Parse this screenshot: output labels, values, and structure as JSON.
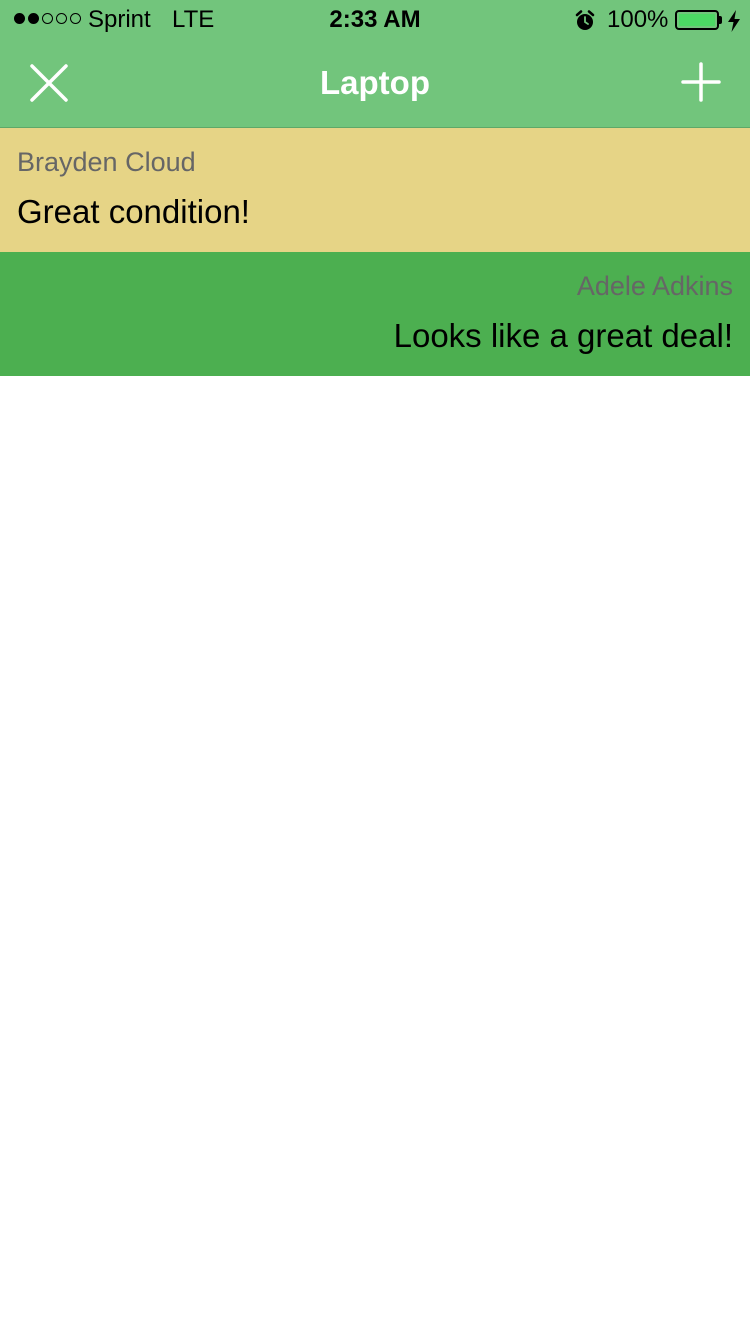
{
  "status_bar": {
    "signal_filled": 2,
    "signal_total": 5,
    "carrier": "Sprint",
    "network": "LTE",
    "time": "2:33 AM",
    "alarm_icon": "alarm-clock-icon",
    "battery_percent": "100%",
    "battery_level": 1.0,
    "battery_color": "#4cd964",
    "charging_icon": "bolt-icon"
  },
  "nav": {
    "title": "Laptop",
    "left_icon": "close-icon",
    "right_icon": "plus-icon",
    "background": "#72c57c"
  },
  "messages": [
    {
      "author": "Brayden Cloud",
      "text": "Great condition!",
      "align": "left",
      "background": "#e6d486"
    },
    {
      "author": "Adele Adkins",
      "text": "Looks like a great deal!",
      "align": "right",
      "background": "#4caf50"
    }
  ]
}
